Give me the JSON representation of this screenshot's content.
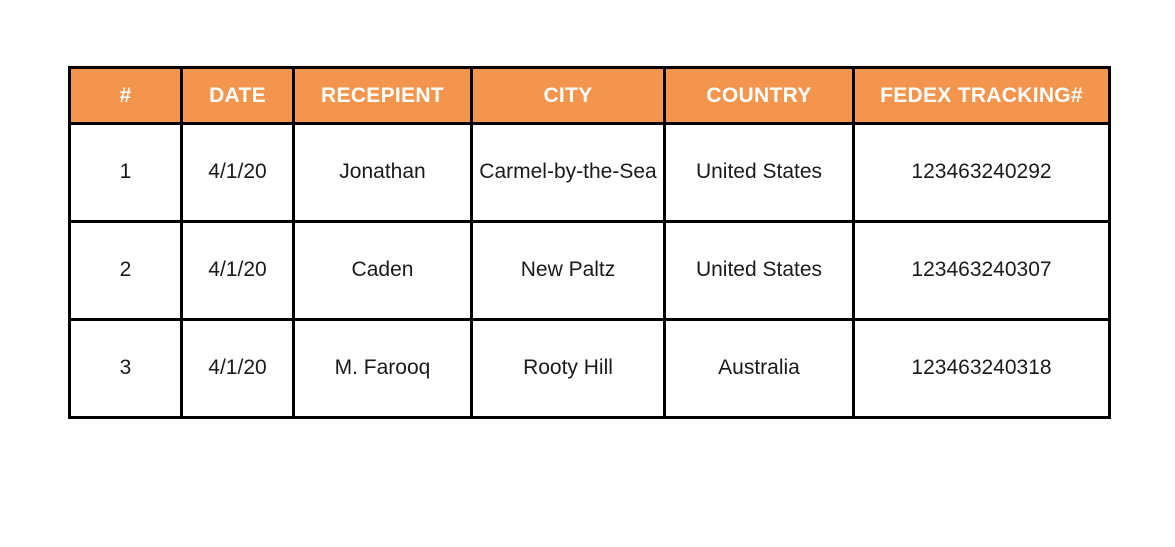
{
  "table": {
    "accent_color": "#F3954D",
    "header_text_color": "#FFFFFF",
    "border_color": "#000000",
    "body_text_color": "#1A1A1A",
    "columns": [
      {
        "key": "index",
        "label": "#"
      },
      {
        "key": "date",
        "label": "DATE"
      },
      {
        "key": "recipient",
        "label": "RECEPIENT"
      },
      {
        "key": "city",
        "label": "CITY"
      },
      {
        "key": "country",
        "label": "COUNTRY"
      },
      {
        "key": "tracking",
        "label": "FEDEX TRACKING#"
      }
    ],
    "rows": [
      {
        "index": "1",
        "date": "4/1/20",
        "recipient": "Jonathan",
        "city": "Carmel-by-the-Sea",
        "country": "United States",
        "tracking": "123463240292"
      },
      {
        "index": "2",
        "date": "4/1/20",
        "recipient": "Caden",
        "city": "New Paltz",
        "country": "United States",
        "tracking": "123463240307"
      },
      {
        "index": "3",
        "date": "4/1/20",
        "recipient": "M. Farooq",
        "city": "Rooty Hill",
        "country": "Australia",
        "tracking": "123463240318"
      }
    ]
  }
}
